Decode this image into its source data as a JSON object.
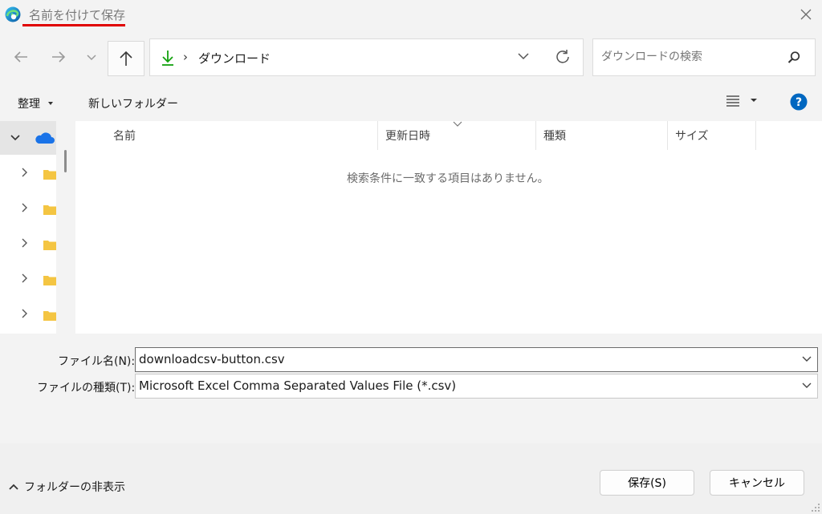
{
  "titlebar": {
    "title": "名前を付けて保存",
    "icons": {
      "app": "edge-browser-icon",
      "close": "close-icon"
    }
  },
  "navigation": {
    "back_icon": "arrow-left-icon",
    "forward_icon": "arrow-right-icon",
    "recent_icon": "chevron-down-icon",
    "up_icon": "arrow-up-icon",
    "address": {
      "location_icon": "download-icon",
      "separator": "›",
      "path": "ダウンロード"
    },
    "search": {
      "placeholder": "ダウンロードの検索"
    }
  },
  "commandbar": {
    "organize": "整理",
    "new_folder": "新しいフォルダー",
    "view_icon": "list-view-icon",
    "help_icon": "help-icon"
  },
  "navpane": {
    "root_icon": "onedrive-cloud-icon",
    "folder_rows": 5
  },
  "filelist": {
    "columns": [
      "名前",
      "更新日時",
      "種類",
      "サイズ"
    ],
    "empty_message": "検索条件に一致する項目はありません。"
  },
  "form": {
    "filename_label": "ファイル名(N):",
    "filename_value": "downloadcsv-button.csv",
    "filetype_label": "ファイルの種類(T):",
    "filetype_value": "Microsoft Excel Comma Separated Values File (*.csv)"
  },
  "footer": {
    "hide_folders": "フォルダーの非表示",
    "save_button": "保存(S)",
    "cancel_button": "キャンセル"
  },
  "colors": {
    "accent": "#0067c0",
    "folder": "#f4c542",
    "highlight_underline": "#e00000",
    "download_green": "#13a10e"
  }
}
